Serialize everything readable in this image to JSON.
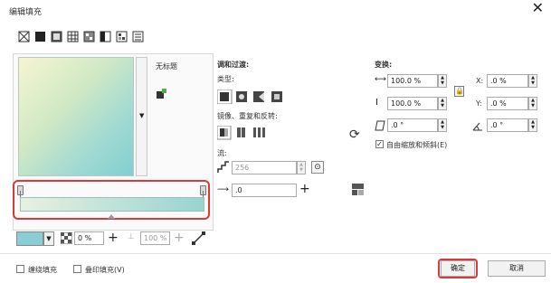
{
  "window": {
    "title": "编辑填充",
    "close_glyph": "✕"
  },
  "toolbar": {
    "icons": [
      "no-fill-icon",
      "uniform-fill-icon",
      "fountain-fill-icon",
      "vector-pattern-icon",
      "bitmap-pattern-icon",
      "two-color-pattern-icon",
      "texture-fill-icon",
      "postscript-fill-icon"
    ]
  },
  "presets": {
    "name": "无标题"
  },
  "blend": {
    "header": "调和过渡:",
    "type_label": "类型:",
    "mirror_label": "镜像、重复和反转:",
    "flow_label": "流:",
    "steps_value": "256",
    "accel_value": ".0"
  },
  "node": {
    "color_hex": "#89cdd5",
    "transparency_value": "0 %",
    "position_value": "100 %"
  },
  "transform": {
    "header": "变换:",
    "width_value": "100.0 %",
    "height_value": "100.0 %",
    "x_label": "X:",
    "x_value": ".0 %",
    "y_label": "Y:",
    "y_value": ".0 %",
    "skew_value": ".0 °",
    "rotate_value": ".0 °",
    "free_scale_label": "自由缩放和倾斜(E)",
    "free_scale_checked": true
  },
  "footer": {
    "wrap_fill_label": "缠绕填充",
    "overprint_label": "叠印填充(V)",
    "ok_label": "确定",
    "cancel_label": "取消"
  }
}
